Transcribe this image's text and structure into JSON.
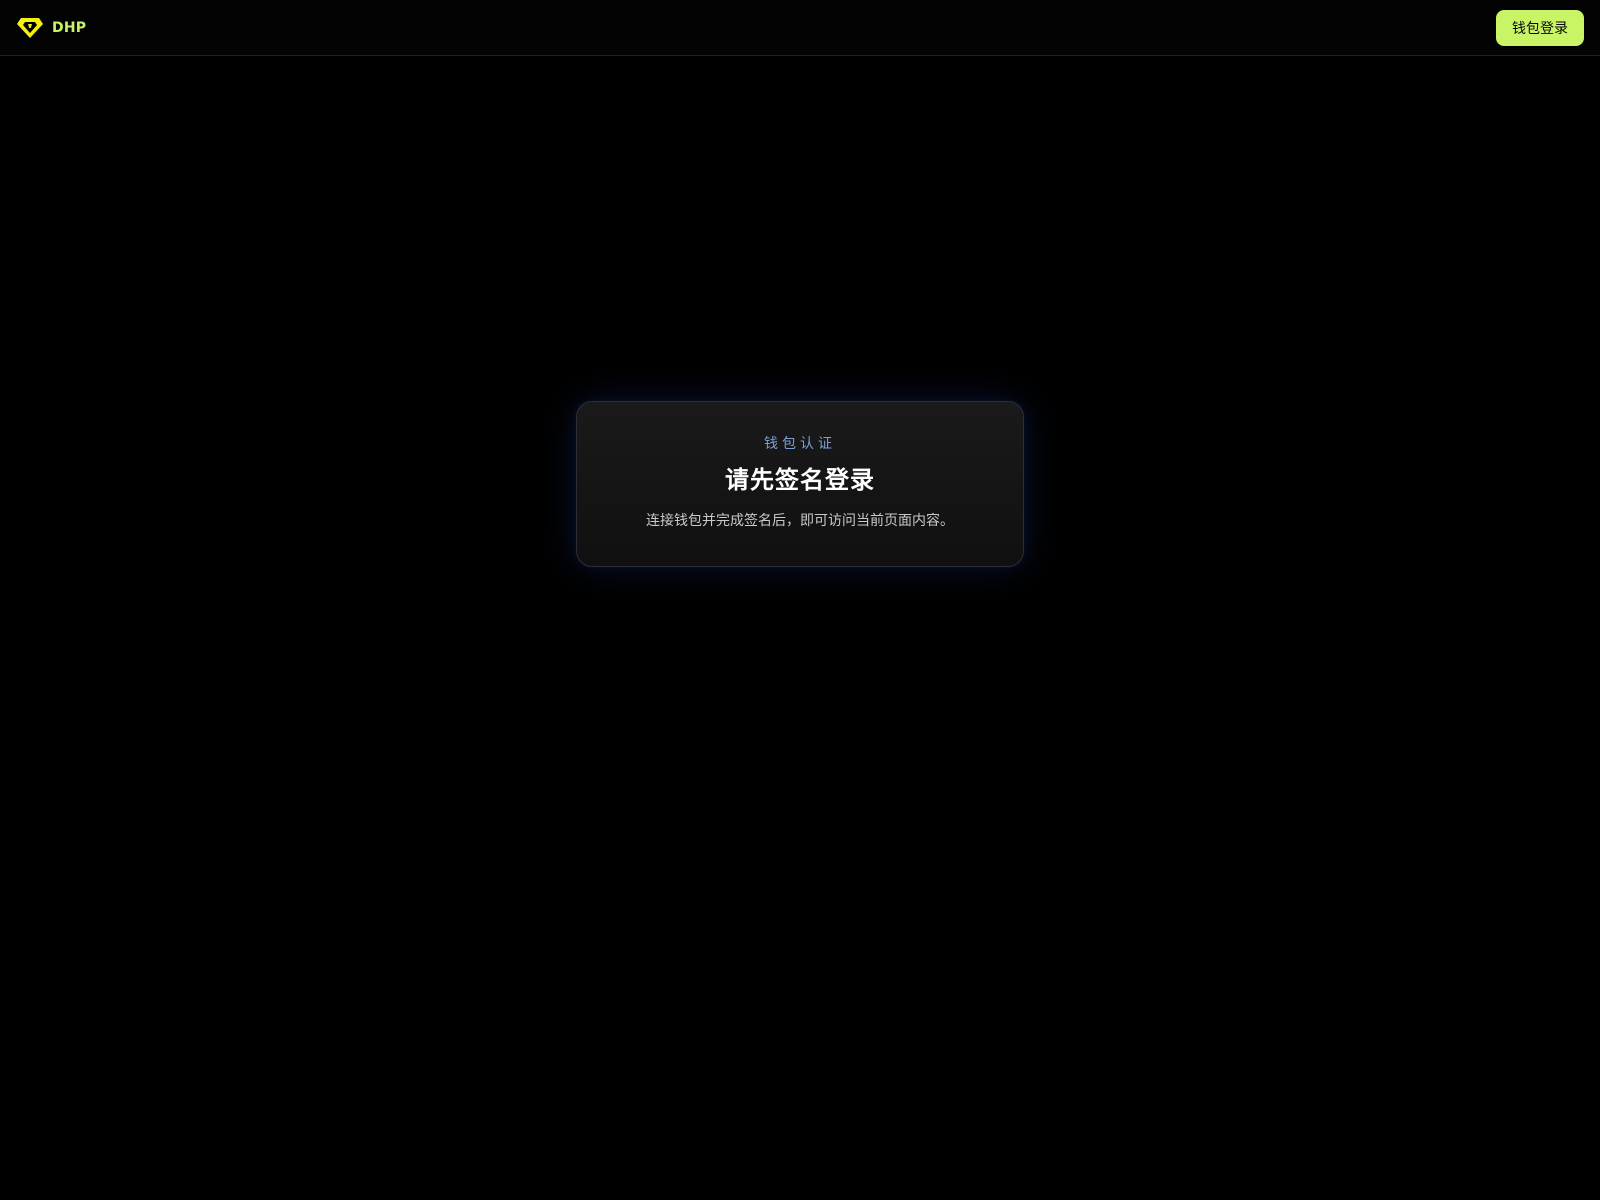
{
  "header": {
    "brand_name": "DHP",
    "brand_logo_icon": "diamond-logo-icon",
    "brand_color": "#c8f465",
    "login_button_label": "钱包登录"
  },
  "auth_card": {
    "eyebrow": "钱包认证",
    "title": "请先签名登录",
    "description": "连接钱包并完成签名后，即可访问当前页面内容。"
  }
}
